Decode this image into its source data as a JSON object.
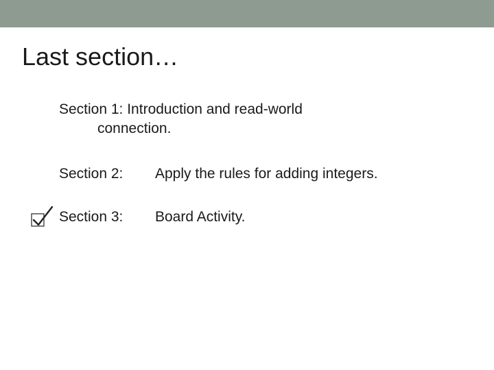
{
  "title": "Last section…",
  "section1": {
    "line1": "Section 1: Introduction and read-world",
    "line2": "connection."
  },
  "section2": {
    "label": "Section 2:",
    "desc": "Apply the rules for adding integers."
  },
  "section3": {
    "label": "Section 3:",
    "desc": "Board Activity."
  }
}
